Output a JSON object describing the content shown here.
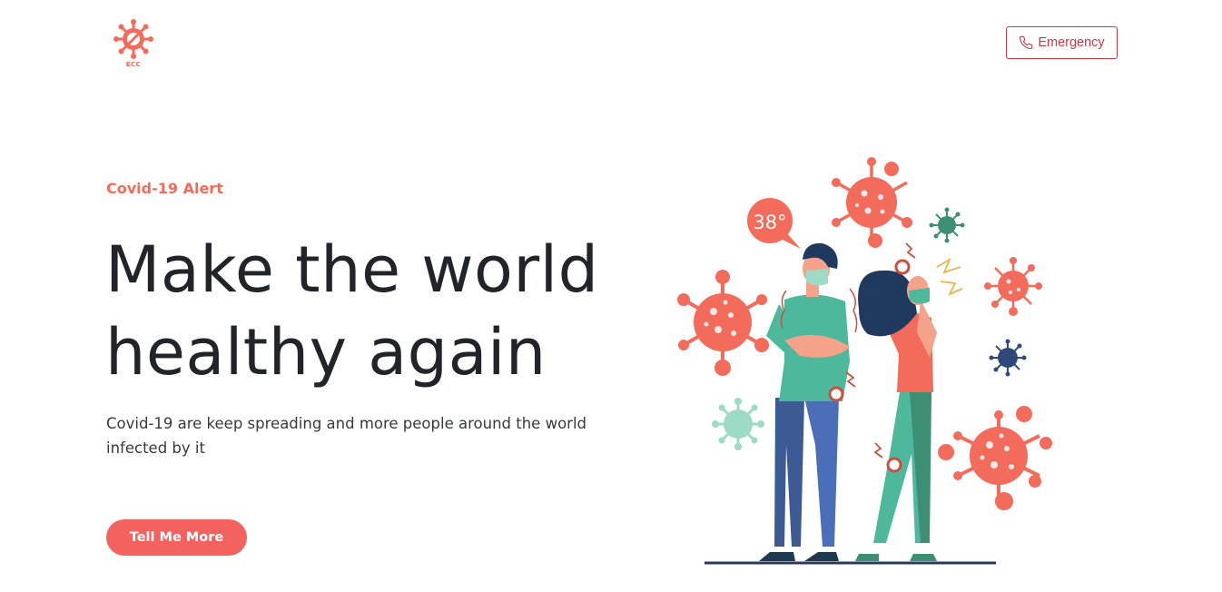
{
  "header": {
    "logo_text": "ECC",
    "emergency_label": "Emergency"
  },
  "hero": {
    "alert_label": "Covid-19 Alert",
    "title_line1": "Make the world",
    "title_line2": "healthy again",
    "description": "Covid-19 are keep spreading and more people around the world infected by it",
    "cta_label": "Tell Me More"
  },
  "illustration": {
    "temperature": "38°"
  },
  "colors": {
    "accent": "#f4625f",
    "emergency": "#c9393f",
    "virus": "#f26b5b",
    "teal": "#4db89b",
    "navy": "#2f4a7a"
  }
}
